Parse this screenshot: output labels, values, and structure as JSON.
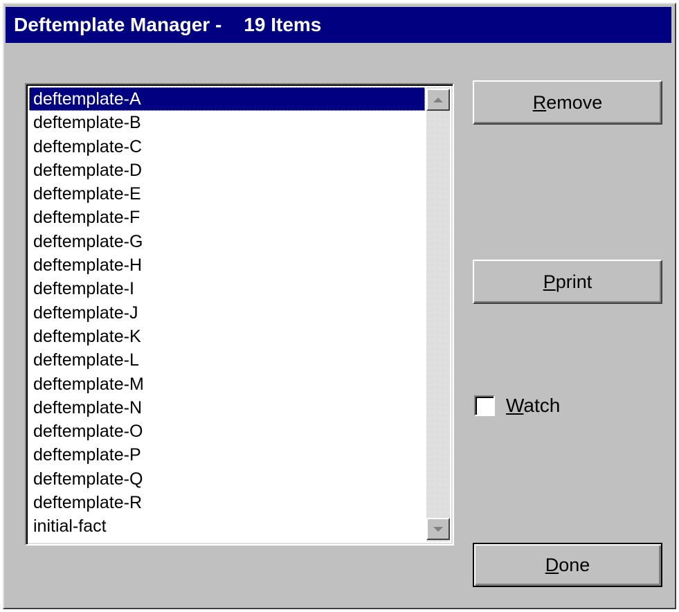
{
  "window": {
    "title": "Deftemplate Manager -",
    "count_label": "19 Items"
  },
  "list": {
    "items": [
      "deftemplate-A",
      "deftemplate-B",
      "deftemplate-C",
      "deftemplate-D",
      "deftemplate-E",
      "deftemplate-F",
      "deftemplate-G",
      "deftemplate-H",
      "deftemplate-I",
      "deftemplate-J",
      "deftemplate-K",
      "deftemplate-L",
      "deftemplate-M",
      "deftemplate-N",
      "deftemplate-O",
      "deftemplate-P",
      "deftemplate-Q",
      "deftemplate-R",
      "initial-fact"
    ],
    "selected_index": 0
  },
  "buttons": {
    "remove": {
      "mnemonic": "R",
      "rest": "emove"
    },
    "pprint": {
      "mnemonic": "P",
      "rest": "print"
    },
    "done": {
      "mnemonic": "D",
      "rest": "one"
    }
  },
  "watch": {
    "mnemonic": "W",
    "rest": "atch",
    "checked": false
  },
  "icons": {
    "scroll_up": "up-arrow-icon",
    "scroll_down": "down-arrow-icon"
  },
  "colors": {
    "titlebar": "#000080",
    "face": "#c0c0c0",
    "selection": "#000080"
  }
}
